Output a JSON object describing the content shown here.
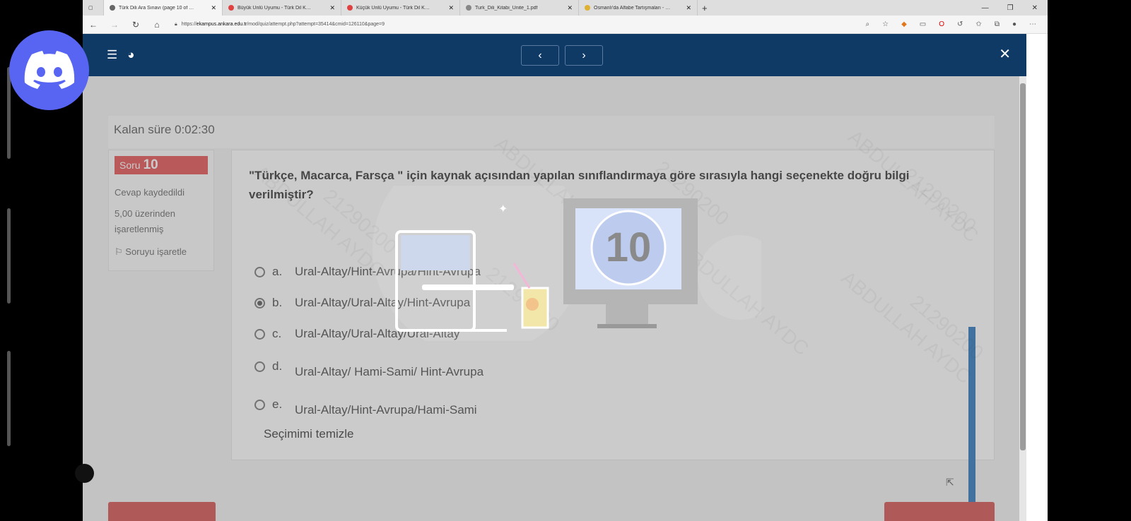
{
  "browser": {
    "tabs": [
      {
        "title": "Türk Dili Ara Sınavı (page 10 of …",
        "fav": "#666666",
        "active": true
      },
      {
        "title": "Büyük Ünlü Uyumu - Türk Dil K…",
        "fav": "#e04040",
        "active": false
      },
      {
        "title": "Küçük Ünlü Uyumu - Türk Dil K…",
        "fav": "#e04040",
        "active": false
      },
      {
        "title": "Turk_Dili_Kitabi_Unite_1.pdf",
        "fav": "#888888",
        "active": false
      },
      {
        "title": "Osmanlı'da Alfabe Tartışmaları - …",
        "fav": "#e0b030",
        "active": false
      }
    ],
    "url_prefix": "https://",
    "url_host": "ekampus.ankara.edu.tr",
    "url_path": "/mod/quiz/attempt.php?attempt=35414&cmid=126110&page=9"
  },
  "header": {
    "prev": "‹",
    "next": "›",
    "close": "✕"
  },
  "timer": "Kalan süre 0:02:30",
  "question_info": {
    "label": "Soru",
    "number": "10",
    "status": "Cevap kaydedildi",
    "mark": "5,00 üzerinden işaretlenmiş",
    "flag": "Soruyu işaretle"
  },
  "question": {
    "text": "\"Türkçe, Macarca, Farsça \" için kaynak açısından yapılan sınıflandırmaya göre sırasıyla hangi seçenekte doğru bilgi verilmiştir?",
    "answers": [
      {
        "letter": "a.",
        "text": "Ural-Altay/Hint-Avrupa/Hint-Avrupa",
        "selected": false
      },
      {
        "letter": "b.",
        "text": "Ural-Altay/Ural-Altay/Hint-Avrupa",
        "selected": true
      },
      {
        "letter": "c.",
        "text": "Ural-Altay/Ural-Altay/Ural-Altay",
        "selected": false
      },
      {
        "letter": "d.",
        "text": "Ural-Altay/ Hami-Sami/ Hint-Avrupa",
        "selected": false
      },
      {
        "letter": "e.",
        "text": "Ural-Altay/Hint-Avrupa/Hami-Sami",
        "selected": false
      }
    ],
    "clear": "Seçimimi temizle"
  },
  "watermark": [
    "ABDULLAH AYDC",
    "21290200"
  ],
  "overlay_countdown": "10",
  "colors": {
    "header": "#0f3a66",
    "accent": "#e03b3b",
    "scrollbar": "#1265b4"
  }
}
